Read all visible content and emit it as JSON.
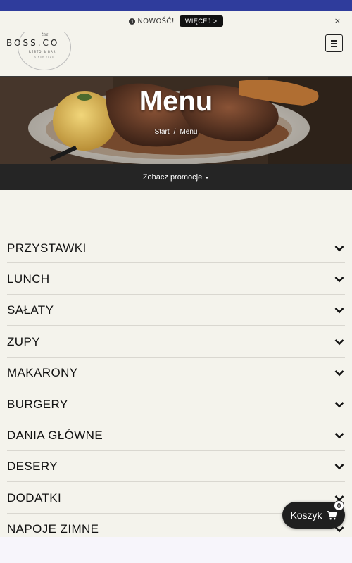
{
  "notice": {
    "text": "NOWOŚĆ!",
    "button_label": "WIĘCEJ >",
    "close_label": "×"
  },
  "logo": {
    "script": "the",
    "main": "BOSS.CO",
    "sub": "RESTO & BAR",
    "since": "SINCE 2020"
  },
  "hero": {
    "title": "Menu",
    "breadcrumb": {
      "home": "Start",
      "separator": "/",
      "current": "Menu"
    }
  },
  "promo": {
    "label": "Zobacz promocje"
  },
  "categories": [
    {
      "label": "PRZYSTAWKI"
    },
    {
      "label": "LUNCH"
    },
    {
      "label": "SAŁATY"
    },
    {
      "label": "ZUPY"
    },
    {
      "label": "MAKARONY"
    },
    {
      "label": "BURGERY"
    },
    {
      "label": "DANIA GŁÓWNE"
    },
    {
      "label": "DESERY"
    },
    {
      "label": "DODATKI"
    },
    {
      "label": "NAPOJE ZIMNE"
    }
  ],
  "cart": {
    "label": "Koszyk",
    "count": "0"
  },
  "colors": {
    "top_bar": "#2f3c9c",
    "background": "#f4f3ec",
    "dark": "#252525"
  },
  "icons": {
    "notice": "info-circle-icon",
    "menu": "hamburger-icon",
    "dropdown": "caret-down-icon",
    "category": "chevron-down-icon",
    "cart": "shopping-cart-icon"
  }
}
